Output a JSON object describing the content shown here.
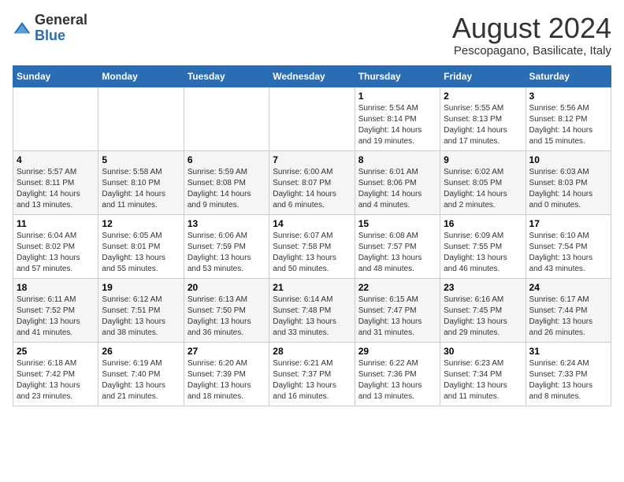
{
  "logo": {
    "general": "General",
    "blue": "Blue"
  },
  "title": "August 2024",
  "subtitle": "Pescopagano, Basilicate, Italy",
  "days_of_week": [
    "Sunday",
    "Monday",
    "Tuesday",
    "Wednesday",
    "Thursday",
    "Friday",
    "Saturday"
  ],
  "weeks": [
    [
      {
        "day": "",
        "sunrise": "",
        "sunset": "",
        "daylight": ""
      },
      {
        "day": "",
        "sunrise": "",
        "sunset": "",
        "daylight": ""
      },
      {
        "day": "",
        "sunrise": "",
        "sunset": "",
        "daylight": ""
      },
      {
        "day": "",
        "sunrise": "",
        "sunset": "",
        "daylight": ""
      },
      {
        "day": "1",
        "sunrise": "Sunrise: 5:54 AM",
        "sunset": "Sunset: 8:14 PM",
        "daylight": "Daylight: 14 hours and 19 minutes."
      },
      {
        "day": "2",
        "sunrise": "Sunrise: 5:55 AM",
        "sunset": "Sunset: 8:13 PM",
        "daylight": "Daylight: 14 hours and 17 minutes."
      },
      {
        "day": "3",
        "sunrise": "Sunrise: 5:56 AM",
        "sunset": "Sunset: 8:12 PM",
        "daylight": "Daylight: 14 hours and 15 minutes."
      }
    ],
    [
      {
        "day": "4",
        "sunrise": "Sunrise: 5:57 AM",
        "sunset": "Sunset: 8:11 PM",
        "daylight": "Daylight: 14 hours and 13 minutes."
      },
      {
        "day": "5",
        "sunrise": "Sunrise: 5:58 AM",
        "sunset": "Sunset: 8:10 PM",
        "daylight": "Daylight: 14 hours and 11 minutes."
      },
      {
        "day": "6",
        "sunrise": "Sunrise: 5:59 AM",
        "sunset": "Sunset: 8:08 PM",
        "daylight": "Daylight: 14 hours and 9 minutes."
      },
      {
        "day": "7",
        "sunrise": "Sunrise: 6:00 AM",
        "sunset": "Sunset: 8:07 PM",
        "daylight": "Daylight: 14 hours and 6 minutes."
      },
      {
        "day": "8",
        "sunrise": "Sunrise: 6:01 AM",
        "sunset": "Sunset: 8:06 PM",
        "daylight": "Daylight: 14 hours and 4 minutes."
      },
      {
        "day": "9",
        "sunrise": "Sunrise: 6:02 AM",
        "sunset": "Sunset: 8:05 PM",
        "daylight": "Daylight: 14 hours and 2 minutes."
      },
      {
        "day": "10",
        "sunrise": "Sunrise: 6:03 AM",
        "sunset": "Sunset: 8:03 PM",
        "daylight": "Daylight: 14 hours and 0 minutes."
      }
    ],
    [
      {
        "day": "11",
        "sunrise": "Sunrise: 6:04 AM",
        "sunset": "Sunset: 8:02 PM",
        "daylight": "Daylight: 13 hours and 57 minutes."
      },
      {
        "day": "12",
        "sunrise": "Sunrise: 6:05 AM",
        "sunset": "Sunset: 8:01 PM",
        "daylight": "Daylight: 13 hours and 55 minutes."
      },
      {
        "day": "13",
        "sunrise": "Sunrise: 6:06 AM",
        "sunset": "Sunset: 7:59 PM",
        "daylight": "Daylight: 13 hours and 53 minutes."
      },
      {
        "day": "14",
        "sunrise": "Sunrise: 6:07 AM",
        "sunset": "Sunset: 7:58 PM",
        "daylight": "Daylight: 13 hours and 50 minutes."
      },
      {
        "day": "15",
        "sunrise": "Sunrise: 6:08 AM",
        "sunset": "Sunset: 7:57 PM",
        "daylight": "Daylight: 13 hours and 48 minutes."
      },
      {
        "day": "16",
        "sunrise": "Sunrise: 6:09 AM",
        "sunset": "Sunset: 7:55 PM",
        "daylight": "Daylight: 13 hours and 46 minutes."
      },
      {
        "day": "17",
        "sunrise": "Sunrise: 6:10 AM",
        "sunset": "Sunset: 7:54 PM",
        "daylight": "Daylight: 13 hours and 43 minutes."
      }
    ],
    [
      {
        "day": "18",
        "sunrise": "Sunrise: 6:11 AM",
        "sunset": "Sunset: 7:52 PM",
        "daylight": "Daylight: 13 hours and 41 minutes."
      },
      {
        "day": "19",
        "sunrise": "Sunrise: 6:12 AM",
        "sunset": "Sunset: 7:51 PM",
        "daylight": "Daylight: 13 hours and 38 minutes."
      },
      {
        "day": "20",
        "sunrise": "Sunrise: 6:13 AM",
        "sunset": "Sunset: 7:50 PM",
        "daylight": "Daylight: 13 hours and 36 minutes."
      },
      {
        "day": "21",
        "sunrise": "Sunrise: 6:14 AM",
        "sunset": "Sunset: 7:48 PM",
        "daylight": "Daylight: 13 hours and 33 minutes."
      },
      {
        "day": "22",
        "sunrise": "Sunrise: 6:15 AM",
        "sunset": "Sunset: 7:47 PM",
        "daylight": "Daylight: 13 hours and 31 minutes."
      },
      {
        "day": "23",
        "sunrise": "Sunrise: 6:16 AM",
        "sunset": "Sunset: 7:45 PM",
        "daylight": "Daylight: 13 hours and 29 minutes."
      },
      {
        "day": "24",
        "sunrise": "Sunrise: 6:17 AM",
        "sunset": "Sunset: 7:44 PM",
        "daylight": "Daylight: 13 hours and 26 minutes."
      }
    ],
    [
      {
        "day": "25",
        "sunrise": "Sunrise: 6:18 AM",
        "sunset": "Sunset: 7:42 PM",
        "daylight": "Daylight: 13 hours and 23 minutes."
      },
      {
        "day": "26",
        "sunrise": "Sunrise: 6:19 AM",
        "sunset": "Sunset: 7:40 PM",
        "daylight": "Daylight: 13 hours and 21 minutes."
      },
      {
        "day": "27",
        "sunrise": "Sunrise: 6:20 AM",
        "sunset": "Sunset: 7:39 PM",
        "daylight": "Daylight: 13 hours and 18 minutes."
      },
      {
        "day": "28",
        "sunrise": "Sunrise: 6:21 AM",
        "sunset": "Sunset: 7:37 PM",
        "daylight": "Daylight: 13 hours and 16 minutes."
      },
      {
        "day": "29",
        "sunrise": "Sunrise: 6:22 AM",
        "sunset": "Sunset: 7:36 PM",
        "daylight": "Daylight: 13 hours and 13 minutes."
      },
      {
        "day": "30",
        "sunrise": "Sunrise: 6:23 AM",
        "sunset": "Sunset: 7:34 PM",
        "daylight": "Daylight: 13 hours and 11 minutes."
      },
      {
        "day": "31",
        "sunrise": "Sunrise: 6:24 AM",
        "sunset": "Sunset: 7:33 PM",
        "daylight": "Daylight: 13 hours and 8 minutes."
      }
    ]
  ]
}
